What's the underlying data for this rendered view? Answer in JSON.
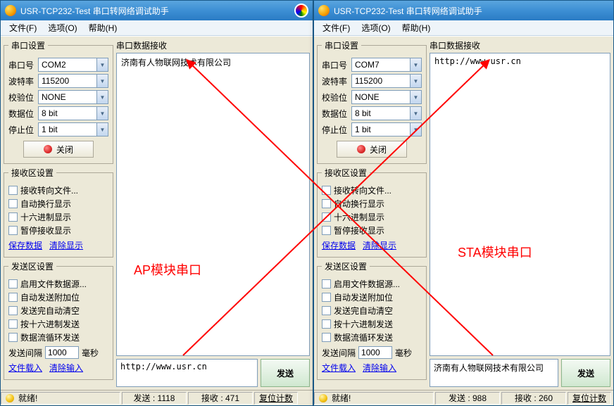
{
  "left_window": {
    "title": "USR-TCP232-Test 串口转网络调试助手",
    "menus": {
      "file": "文件(F)",
      "options": "选项(O)",
      "help": "帮助(H)"
    },
    "serial_group": "串口设置",
    "labels": {
      "port": "串口号",
      "baud": "波特率",
      "parity": "校验位",
      "data": "数据位",
      "stop": "停止位"
    },
    "values": {
      "port": "COM2",
      "baud": "115200",
      "parity": "NONE",
      "data": "8 bit",
      "stop": "1 bit"
    },
    "close_btn": "关闭",
    "recv_group": "接收区设置",
    "recv_opts": {
      "tofile": "接收转向文件...",
      "autowrap": "自动换行显示",
      "hex": "十六进制显示",
      "pause": "暂停接收显示"
    },
    "recv_links": {
      "save": "保存数据",
      "clear": "清除显示"
    },
    "send_group": "发送区设置",
    "send_opts": {
      "fromfile": "启用文件数据源...",
      "autoclr_append": "自动发送附加位",
      "autoclr_done": "发送完自动清空",
      "hex_send": "按十六进制发送",
      "loop": "数据流循环发送"
    },
    "interval": {
      "label": "发送间隔",
      "value": "1000",
      "unit": "毫秒"
    },
    "send_links": {
      "load": "文件载入",
      "clear": "清除输入"
    },
    "recv_label": "串口数据接收",
    "recv_text": "济南有人物联网技术有限公司",
    "send_text": "http://www.usr.cn",
    "send_btn": "发送",
    "status": {
      "ready": "就绪!",
      "tx": "发送 : 1118",
      "rx": "接收 : 471",
      "reset": "复位计数"
    },
    "annotation": "AP模块串口"
  },
  "right_window": {
    "title": "USR-TCP232-Test 串口转网络调试助手",
    "menus": {
      "file": "文件(F)",
      "options": "选项(O)",
      "help": "帮助(H)"
    },
    "serial_group": "串口设置",
    "labels": {
      "port": "串口号",
      "baud": "波特率",
      "parity": "校验位",
      "data": "数据位",
      "stop": "停止位"
    },
    "values": {
      "port": "COM7",
      "baud": "115200",
      "parity": "NONE",
      "data": "8 bit",
      "stop": "1 bit"
    },
    "close_btn": "关闭",
    "recv_group": "接收区设置",
    "recv_opts": {
      "tofile": "接收转向文件...",
      "autowrap": "自动换行显示",
      "hex": "十六进制显示",
      "pause": "暂停接收显示"
    },
    "recv_links": {
      "save": "保存数据",
      "clear": "清除显示"
    },
    "send_group": "发送区设置",
    "send_opts": {
      "fromfile": "启用文件数据源...",
      "autoclr_append": "自动发送附加位",
      "autoclr_done": "发送完自动清空",
      "hex_send": "按十六进制发送",
      "loop": "数据流循环发送"
    },
    "interval": {
      "label": "发送间隔",
      "value": "1000",
      "unit": "毫秒"
    },
    "send_links": {
      "load": "文件载入",
      "clear": "清除输入"
    },
    "recv_label": "串口数据接收",
    "recv_text": "http://www.usr.cn",
    "send_text": "济南有人物联网技术有限公司",
    "send_btn": "发送",
    "status": {
      "ready": "就绪!",
      "tx": "发送 : 988",
      "rx": "接收 : 260",
      "reset": "复位计数"
    },
    "annotation": "STA模块串口"
  }
}
